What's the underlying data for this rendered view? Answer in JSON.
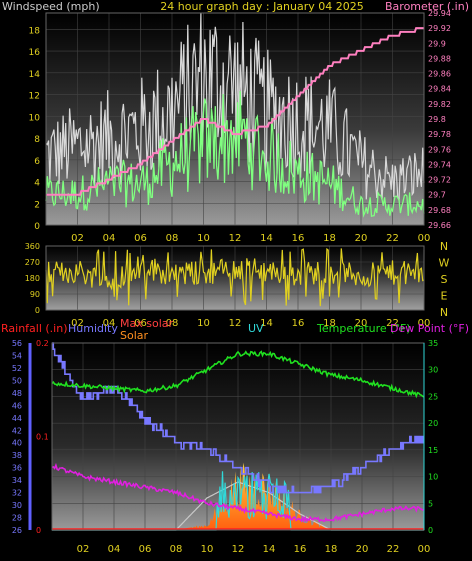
{
  "panel1": {
    "title_left": "Windspeed (mph)",
    "title_center": "24 hour graph day : January 04 2025",
    "title_right": "Barometer (.in)",
    "yleft_ticks": [
      "0",
      "2",
      "4",
      "6",
      "8",
      "10",
      "12",
      "14",
      "16",
      "18"
    ],
    "yright_ticks": [
      "29.66",
      "29.68",
      "29.7",
      "29.72",
      "29.74",
      "29.76",
      "29.78",
      "29.8",
      "29.82",
      "29.84",
      "29.86",
      "29.88",
      "29.9",
      "29.92",
      "29.94"
    ],
    "x_ticks": [
      "02",
      "04",
      "06",
      "08",
      "10",
      "12",
      "14",
      "16",
      "18",
      "20",
      "22",
      "00"
    ]
  },
  "panel2": {
    "y_ticks": [
      "360",
      "270",
      "180",
      "90",
      "0"
    ],
    "compass": [
      "N",
      "W",
      "S",
      "E",
      "N"
    ],
    "x_ticks": [
      "02",
      "04",
      "06",
      "08",
      "10",
      "12",
      "14",
      "16",
      "18",
      "20",
      "22",
      "00"
    ]
  },
  "panel3": {
    "label_rain": "Rainfall (.in)",
    "label_humidity": "Humidity",
    "label_maxsolar": "Max solar",
    "label_solar": "Solar",
    "label_uv": "UV",
    "label_temp": "Temperature (°F)",
    "label_dew": "Dew Point (°F)",
    "rain_ticks": [
      "0",
      "0.1",
      "0.2"
    ],
    "humidity_ticks": [
      "26",
      "28",
      "30",
      "32",
      "34",
      "36",
      "38",
      "40",
      "42",
      "44",
      "46",
      "48",
      "50",
      "52",
      "54",
      "56"
    ],
    "temp_ticks": [
      "0",
      "5",
      "10",
      "15",
      "20",
      "25",
      "30",
      "35"
    ],
    "x_ticks": [
      "02",
      "04",
      "06",
      "08",
      "10",
      "12",
      "14",
      "16",
      "18",
      "20",
      "22",
      "00"
    ]
  },
  "colors": {
    "gust": "#d8d8d8",
    "wind": "#80ff80",
    "barometer": "#ff80c0",
    "direction": "#e0d020",
    "humidity": "#7878ff",
    "temperature": "#20e020",
    "dewpoint": "#e020e0",
    "solar": "#ff9020",
    "maxsolar": "#c8c8c8",
    "uv": "#30d8d8",
    "rain": "#ff2020"
  },
  "chart_data": [
    {
      "type": "line",
      "title": "24 hour graph day : January 04 2025",
      "ylabel": "Windspeed (mph)",
      "y2label": "Barometer (.in)",
      "x": [
        "00",
        "02",
        "04",
        "06",
        "08",
        "10",
        "12",
        "14",
        "16",
        "18",
        "20",
        "22",
        "00"
      ],
      "ylim": [
        0,
        19.5
      ],
      "y2lim": [
        29.66,
        29.94
      ],
      "series": [
        {
          "name": "Wind gust",
          "values": [
            8,
            9,
            10,
            11,
            13,
            17,
            16,
            13,
            12,
            11,
            7,
            5,
            6
          ]
        },
        {
          "name": "Wind speed",
          "values": [
            3,
            3,
            4,
            4,
            6,
            8,
            9,
            7,
            5,
            4,
            2,
            2,
            2
          ]
        },
        {
          "name": "Barometer",
          "values": [
            29.7,
            29.7,
            29.72,
            29.74,
            29.77,
            29.8,
            29.78,
            29.79,
            29.83,
            29.87,
            29.89,
            29.91,
            29.92
          ]
        }
      ]
    },
    {
      "type": "line",
      "title": "",
      "ylabel": "",
      "x": [
        "00",
        "02",
        "04",
        "06",
        "08",
        "10",
        "12",
        "14",
        "16",
        "18",
        "20",
        "22",
        "00"
      ],
      "ylim": [
        0,
        360
      ],
      "series": [
        {
          "name": "Wind direction",
          "values": [
            200,
            220,
            160,
            250,
            200,
            210,
            230,
            220,
            200,
            220,
            190,
            210,
            200
          ]
        }
      ]
    },
    {
      "type": "line",
      "title": "",
      "x": [
        "00",
        "02",
        "04",
        "06",
        "08",
        "10",
        "12",
        "14",
        "16",
        "18",
        "20",
        "22",
        "00"
      ],
      "series": [
        {
          "name": "Humidity",
          "values": [
            55,
            47,
            49,
            44,
            40,
            39,
            36,
            33,
            32,
            33,
            36,
            39,
            41
          ]
        },
        {
          "name": "Temperature (°F)",
          "values": [
            27.5,
            27,
            26.5,
            26,
            27,
            30,
            33,
            33,
            31,
            29,
            28,
            26.5,
            25
          ]
        },
        {
          "name": "Dew Point (°F)",
          "values": [
            12,
            10,
            9,
            8,
            7,
            5,
            4,
            3,
            2,
            2,
            3,
            4,
            4
          ]
        },
        {
          "name": "Solar",
          "values": [
            0,
            0,
            0,
            0,
            0,
            1,
            10,
            9,
            3,
            0,
            0,
            0,
            0
          ]
        },
        {
          "name": "Max solar",
          "values": [
            0,
            0,
            0,
            0,
            0,
            6,
            9,
            7,
            3,
            0,
            0,
            0,
            0
          ]
        },
        {
          "name": "UV",
          "values": [
            0,
            0,
            0,
            0,
            0,
            0,
            1,
            1,
            0,
            0,
            0,
            0,
            0
          ]
        },
        {
          "name": "Rainfall (.in)",
          "values": [
            0,
            0,
            0,
            0,
            0,
            0,
            0,
            0,
            0,
            0,
            0,
            0,
            0
          ]
        }
      ],
      "humidity_ylim": [
        26,
        56
      ],
      "temp_ylim": [
        0,
        35
      ],
      "rain_ylim": [
        0,
        0.2
      ]
    }
  ]
}
